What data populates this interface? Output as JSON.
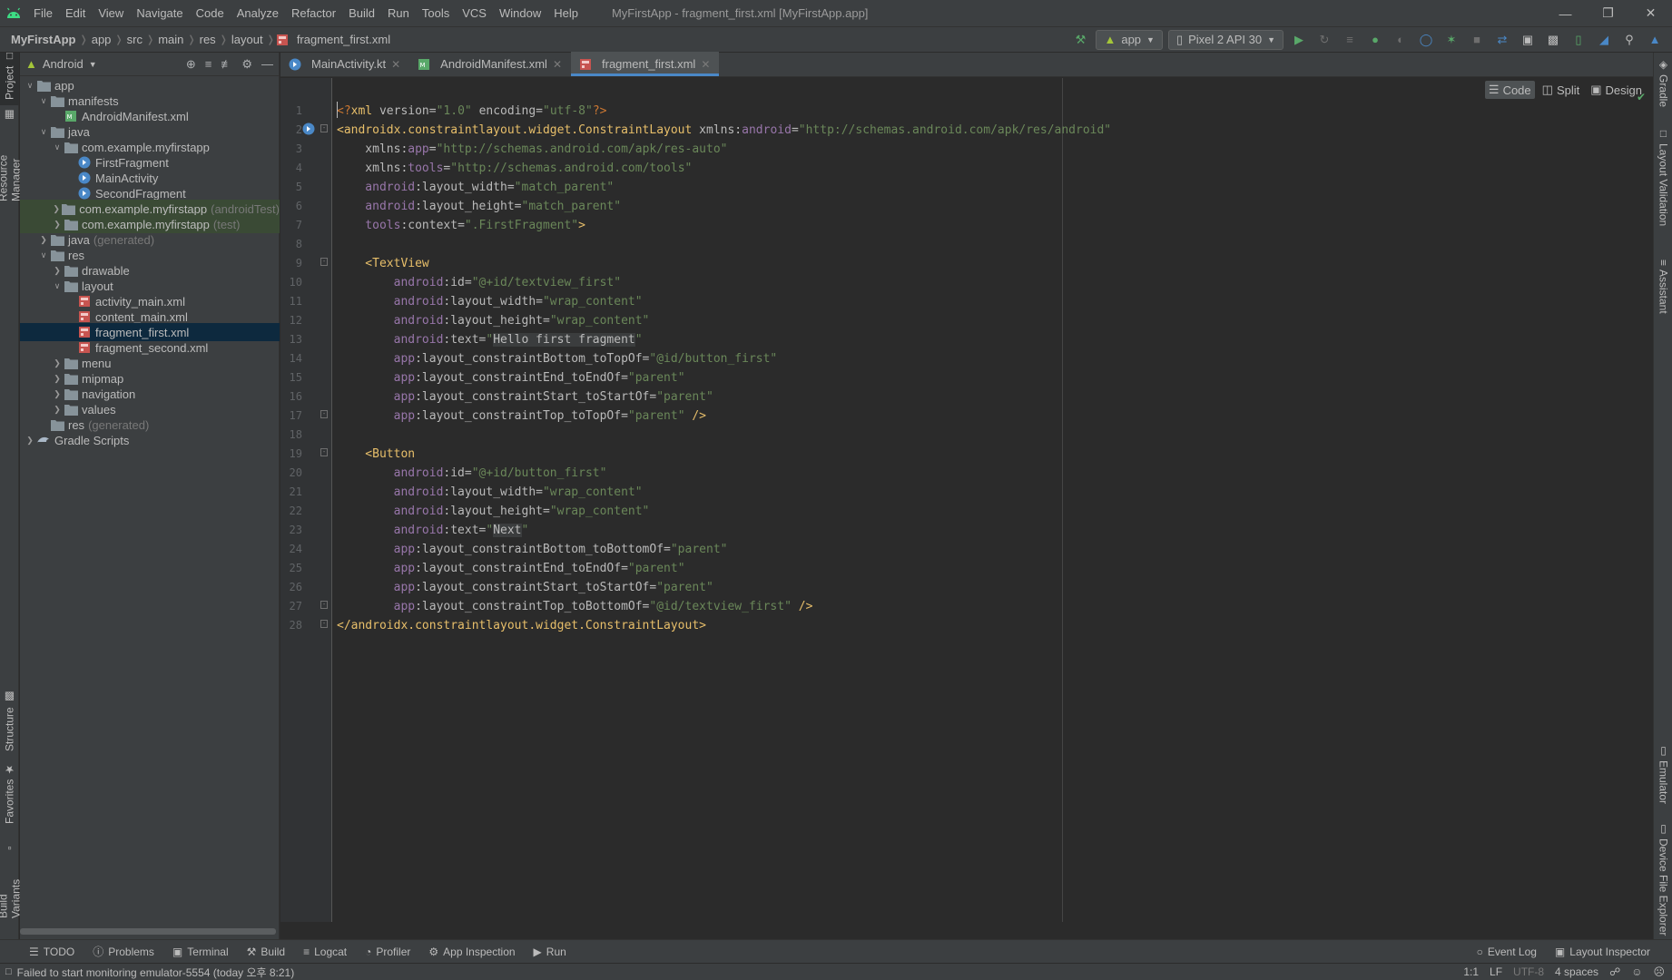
{
  "menubar": {
    "items": [
      "File",
      "Edit",
      "View",
      "Navigate",
      "Code",
      "Analyze",
      "Refactor",
      "Build",
      "Run",
      "Tools",
      "VCS",
      "Window",
      "Help"
    ],
    "window_title": "MyFirstApp - fragment_first.xml [MyFirstApp.app]"
  },
  "breadcrumb": [
    "MyFirstApp",
    "app",
    "src",
    "main",
    "res",
    "layout",
    "fragment_first.xml"
  ],
  "toolbar": {
    "run_config": "app",
    "device": "Pixel 2 API 30"
  },
  "project_panel": {
    "view_selector": "Android",
    "tree": [
      {
        "label": "app",
        "suffix": "",
        "depth": 0,
        "expanded": true,
        "icon": "module-folder-icon"
      },
      {
        "label": "manifests",
        "suffix": "",
        "depth": 1,
        "expanded": true,
        "icon": "folder-icon"
      },
      {
        "label": "AndroidManifest.xml",
        "suffix": "",
        "depth": 2,
        "expanded": null,
        "icon": "manifest-icon"
      },
      {
        "label": "java",
        "suffix": "",
        "depth": 1,
        "expanded": true,
        "icon": "folder-icon"
      },
      {
        "label": "com.example.myfirstapp",
        "suffix": "",
        "depth": 2,
        "expanded": true,
        "icon": "package-icon"
      },
      {
        "label": "FirstFragment",
        "suffix": "",
        "depth": 3,
        "expanded": null,
        "icon": "kotlin-class-icon"
      },
      {
        "label": "MainActivity",
        "suffix": "",
        "depth": 3,
        "expanded": null,
        "icon": "kotlin-class-icon"
      },
      {
        "label": "SecondFragment",
        "suffix": "",
        "depth": 3,
        "expanded": null,
        "icon": "kotlin-class-icon"
      },
      {
        "label": "com.example.myfirstapp",
        "suffix": "(androidTest)",
        "depth": 2,
        "expanded": false,
        "icon": "package-icon",
        "test": true
      },
      {
        "label": "com.example.myfirstapp",
        "suffix": "(test)",
        "depth": 2,
        "expanded": false,
        "icon": "package-icon",
        "test": true
      },
      {
        "label": "java",
        "suffix": "(generated)",
        "depth": 1,
        "expanded": false,
        "icon": "folder-icon"
      },
      {
        "label": "res",
        "suffix": "",
        "depth": 1,
        "expanded": true,
        "icon": "res-folder-icon"
      },
      {
        "label": "drawable",
        "suffix": "",
        "depth": 2,
        "expanded": false,
        "icon": "folder-icon"
      },
      {
        "label": "layout",
        "suffix": "",
        "depth": 2,
        "expanded": true,
        "icon": "folder-icon"
      },
      {
        "label": "activity_main.xml",
        "suffix": "",
        "depth": 3,
        "expanded": null,
        "icon": "layout-file-icon"
      },
      {
        "label": "content_main.xml",
        "suffix": "",
        "depth": 3,
        "expanded": null,
        "icon": "layout-file-icon"
      },
      {
        "label": "fragment_first.xml",
        "suffix": "",
        "depth": 3,
        "expanded": null,
        "icon": "layout-file-icon",
        "selected": true
      },
      {
        "label": "fragment_second.xml",
        "suffix": "",
        "depth": 3,
        "expanded": null,
        "icon": "layout-file-icon"
      },
      {
        "label": "menu",
        "suffix": "",
        "depth": 2,
        "expanded": false,
        "icon": "folder-icon"
      },
      {
        "label": "mipmap",
        "suffix": "",
        "depth": 2,
        "expanded": false,
        "icon": "folder-icon"
      },
      {
        "label": "navigation",
        "suffix": "",
        "depth": 2,
        "expanded": false,
        "icon": "folder-icon"
      },
      {
        "label": "values",
        "suffix": "",
        "depth": 2,
        "expanded": false,
        "icon": "folder-icon"
      },
      {
        "label": "res",
        "suffix": "(generated)",
        "depth": 1,
        "expanded": null,
        "icon": "res-folder-icon"
      },
      {
        "label": "Gradle Scripts",
        "suffix": "",
        "depth": 0,
        "expanded": false,
        "icon": "gradle-icon"
      }
    ]
  },
  "left_tool_tabs": [
    "Project",
    "Resource Manager",
    "Structure",
    "Favorites",
    "Build Variants"
  ],
  "right_tool_tabs": [
    "Gradle",
    "Layout Validation",
    "Assistant",
    "Emulator",
    "Device File Explorer"
  ],
  "editor_tabs": [
    {
      "label": "MainActivity.kt",
      "icon": "kotlin-file-icon",
      "active": false
    },
    {
      "label": "AndroidManifest.xml",
      "icon": "manifest-icon",
      "active": false
    },
    {
      "label": "fragment_first.xml",
      "icon": "layout-file-icon",
      "active": true
    }
  ],
  "view_modes": [
    "Code",
    "Split",
    "Design"
  ],
  "code_lines": [
    [
      [
        "p",
        "<?"
      ],
      [
        "t",
        "xml "
      ],
      [
        "a",
        "version="
      ],
      [
        "s",
        "\"1.0\" "
      ],
      [
        "a",
        "encoding="
      ],
      [
        "s",
        "\"utf-8\""
      ],
      [
        "p",
        "?>"
      ]
    ],
    [
      [
        "t",
        "<androidx.constraintlayout.widget.ConstraintLayout "
      ],
      [
        "a",
        "xmlns:"
      ],
      [
        "ns",
        "android"
      ],
      [
        "a",
        "="
      ],
      [
        "s",
        "\"http://schemas.android.com/apk/res/android\""
      ]
    ],
    [
      [
        "a",
        "    xmlns:"
      ],
      [
        "ns",
        "app"
      ],
      [
        "a",
        "="
      ],
      [
        "s",
        "\"http://schemas.android.com/apk/res-auto\""
      ]
    ],
    [
      [
        "a",
        "    xmlns:"
      ],
      [
        "ns",
        "tools"
      ],
      [
        "a",
        "="
      ],
      [
        "s",
        "\"http://schemas.android.com/tools\""
      ]
    ],
    [
      [
        "ns",
        "    android"
      ],
      [
        "a",
        ":layout_width="
      ],
      [
        "s",
        "\"match_parent\""
      ]
    ],
    [
      [
        "ns",
        "    android"
      ],
      [
        "a",
        ":layout_height="
      ],
      [
        "s",
        "\"match_parent\""
      ]
    ],
    [
      [
        "ns",
        "    tools"
      ],
      [
        "a",
        ":context="
      ],
      [
        "s",
        "\".FirstFragment\""
      ],
      [
        "t",
        ">"
      ]
    ],
    [
      [
        "a",
        ""
      ]
    ],
    [
      [
        "t",
        "    <TextView"
      ]
    ],
    [
      [
        "ns",
        "        android"
      ],
      [
        "a",
        ":id="
      ],
      [
        "s",
        "\"@+id/textview_first\""
      ]
    ],
    [
      [
        "ns",
        "        android"
      ],
      [
        "a",
        ":layout_width="
      ],
      [
        "s",
        "\"wrap_content\""
      ]
    ],
    [
      [
        "ns",
        "        android"
      ],
      [
        "a",
        ":layout_height="
      ],
      [
        "s",
        "\"wrap_content\""
      ]
    ],
    [
      [
        "ns",
        "        android"
      ],
      [
        "a",
        ":text="
      ],
      [
        "s",
        "\""
      ],
      [
        "hl",
        "Hello first fragment"
      ],
      [
        "s",
        "\""
      ]
    ],
    [
      [
        "ns",
        "        app"
      ],
      [
        "a",
        ":layout_constraintBottom_toTopOf="
      ],
      [
        "s",
        "\"@id/button_first\""
      ]
    ],
    [
      [
        "ns",
        "        app"
      ],
      [
        "a",
        ":layout_constraintEnd_toEndOf="
      ],
      [
        "s",
        "\"parent\""
      ]
    ],
    [
      [
        "ns",
        "        app"
      ],
      [
        "a",
        ":layout_constraintStart_toStartOf="
      ],
      [
        "s",
        "\"parent\""
      ]
    ],
    [
      [
        "ns",
        "        app"
      ],
      [
        "a",
        ":layout_constraintTop_toTopOf="
      ],
      [
        "s",
        "\"parent\" "
      ],
      [
        "t",
        "/>"
      ]
    ],
    [
      [
        "a",
        ""
      ]
    ],
    [
      [
        "t",
        "    <Button"
      ]
    ],
    [
      [
        "ns",
        "        android"
      ],
      [
        "a",
        ":id="
      ],
      [
        "s",
        "\"@+id/button_first\""
      ]
    ],
    [
      [
        "ns",
        "        android"
      ],
      [
        "a",
        ":layout_width="
      ],
      [
        "s",
        "\"wrap_content\""
      ]
    ],
    [
      [
        "ns",
        "        android"
      ],
      [
        "a",
        ":layout_height="
      ],
      [
        "s",
        "\"wrap_content\""
      ]
    ],
    [
      [
        "ns",
        "        android"
      ],
      [
        "a",
        ":text="
      ],
      [
        "s",
        "\""
      ],
      [
        "hl",
        "Next"
      ],
      [
        "s",
        "\""
      ]
    ],
    [
      [
        "ns",
        "        app"
      ],
      [
        "a",
        ":layout_constraintBottom_toBottomOf="
      ],
      [
        "s",
        "\"parent\""
      ]
    ],
    [
      [
        "ns",
        "        app"
      ],
      [
        "a",
        ":layout_constraintEnd_toEndOf="
      ],
      [
        "s",
        "\"parent\""
      ]
    ],
    [
      [
        "ns",
        "        app"
      ],
      [
        "a",
        ":layout_constraintStart_toStartOf="
      ],
      [
        "s",
        "\"parent\""
      ]
    ],
    [
      [
        "ns",
        "        app"
      ],
      [
        "a",
        ":layout_constraintTop_toBottomOf="
      ],
      [
        "s",
        "\"@id/textview_first\" "
      ],
      [
        "t",
        "/>"
      ]
    ],
    [
      [
        "t",
        "</androidx.constraintlayout.widget.ConstraintLayout>"
      ]
    ]
  ],
  "bottom_tabs": [
    "TODO",
    "Problems",
    "Terminal",
    "Build",
    "Logcat",
    "Profiler",
    "App Inspection",
    "Run"
  ],
  "bottom_right_tabs": [
    "Event Log",
    "Layout Inspector"
  ],
  "status": {
    "message": "Failed to start monitoring emulator-5554 (today 오후 8:21)",
    "position": "1:1",
    "line_sep": "LF",
    "encoding": "UTF-8",
    "indent": "4 spaces"
  },
  "colors": {
    "accent": "#4a88c7",
    "android_green": "#a4c639",
    "selected_row": "#0d293e",
    "test_row": "#3a4a35"
  }
}
